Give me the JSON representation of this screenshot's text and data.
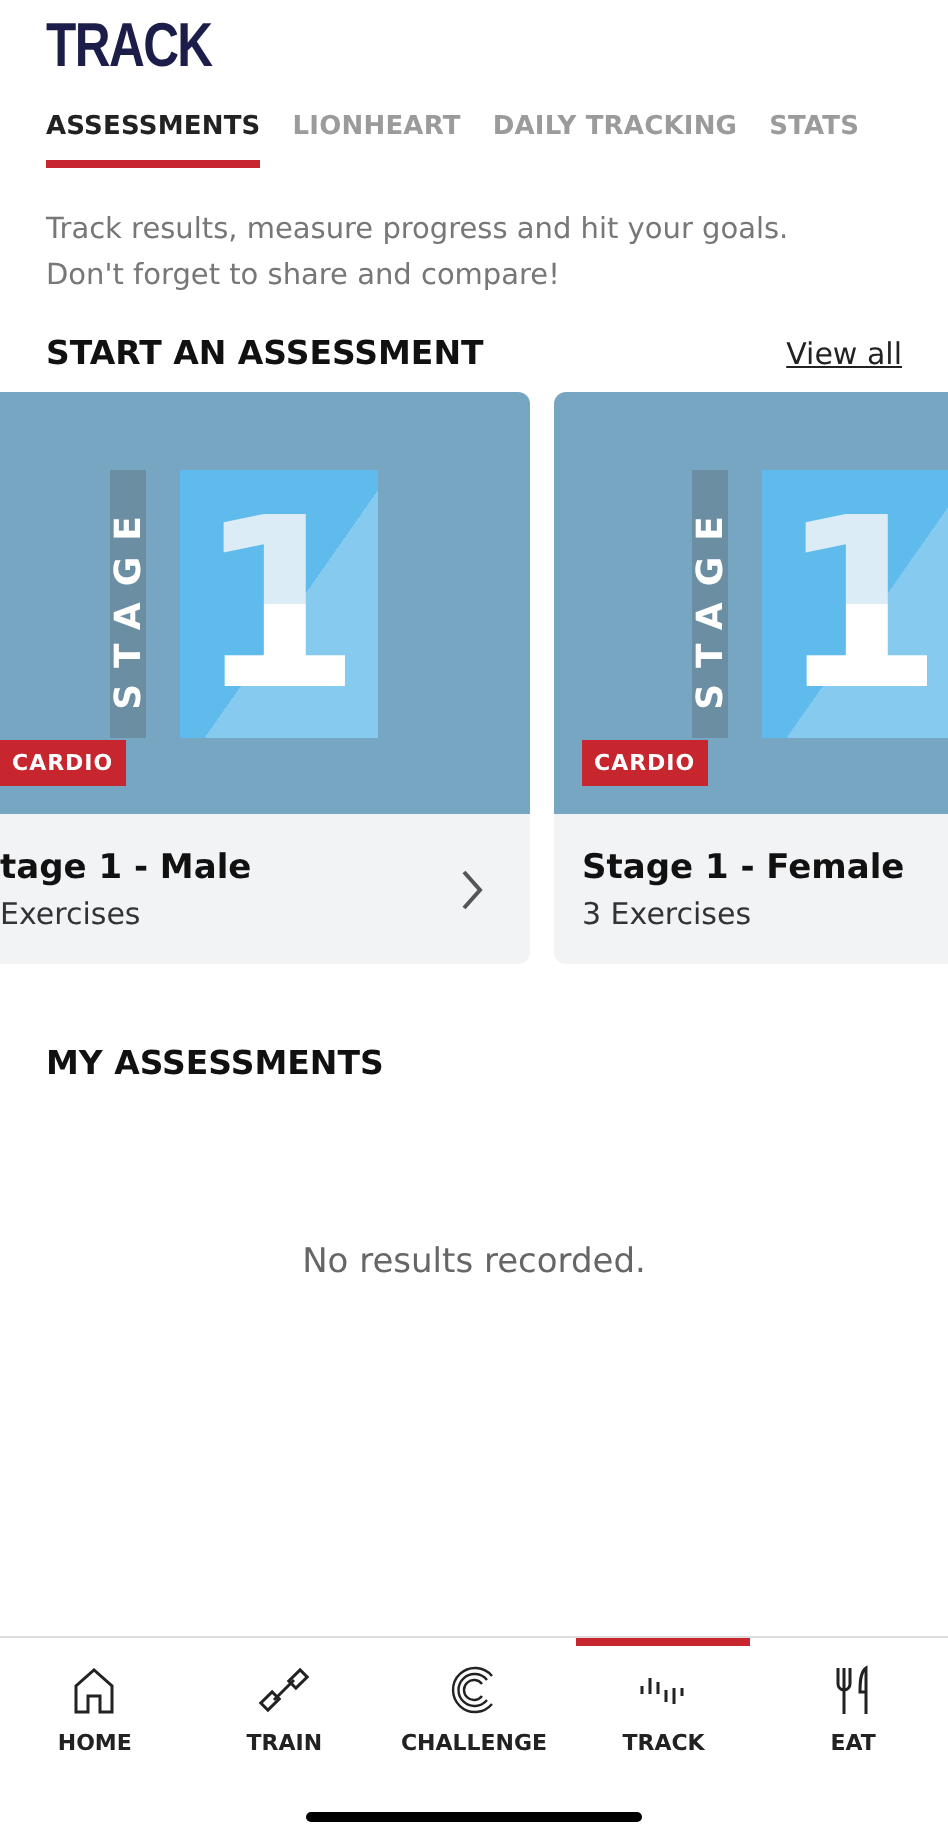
{
  "header": {
    "title": "TRACK"
  },
  "tabs": [
    {
      "label": "ASSESSMENTS",
      "selected": true
    },
    {
      "label": "LIONHEART",
      "selected": false
    },
    {
      "label": "DAILY TRACKING",
      "selected": false
    },
    {
      "label": "STATS",
      "selected": false
    }
  ],
  "intro": "Track results, measure progress and hit your goals. Don't forget to share and compare!",
  "start_section": {
    "heading": "START AN ASSESSMENT",
    "link": "View all"
  },
  "cards": [
    {
      "stage_word": "STAGE",
      "stage_number": "1",
      "badge": "CARDIO",
      "title": "tage 1 - Male",
      "subtitle": "Exercises",
      "chevron": true
    },
    {
      "stage_word": "STAGE",
      "stage_number": "1",
      "badge": "CARDIO",
      "title": "Stage 1 - Female",
      "subtitle": "3 Exercises",
      "chevron": false
    }
  ],
  "my_section": {
    "heading": "MY ASSESSMENTS",
    "empty_message": "No results recorded."
  },
  "bottom_nav": [
    {
      "kind": "home",
      "label": "HOME",
      "selected": false
    },
    {
      "kind": "train",
      "label": "TRAIN",
      "selected": false
    },
    {
      "kind": "challenge",
      "label": "CHALLENGE",
      "selected": false
    },
    {
      "kind": "track",
      "label": "TRACK",
      "selected": true
    },
    {
      "kind": "eat",
      "label": "EAT",
      "selected": false
    }
  ]
}
